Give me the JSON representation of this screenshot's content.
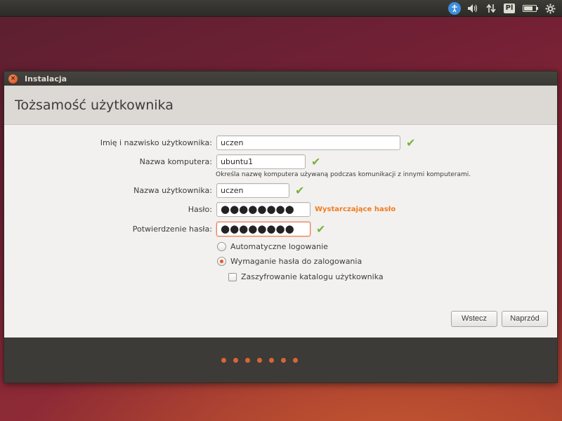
{
  "panel": {
    "keyboard_layout": "Pl",
    "icons": [
      "accessibility-icon",
      "volume-icon",
      "network-icon",
      "keyboard-layout-icon",
      "battery-icon",
      "settings-gear-icon"
    ],
    "battery_level": 0.75
  },
  "window": {
    "title": "Instalacja",
    "page_title": "Tożsamość użytkownika"
  },
  "form": {
    "fullname": {
      "label": "Imię i nazwisko użytkownika:",
      "value": "uczen",
      "valid": true
    },
    "computer": {
      "label": "Nazwa komputera:",
      "value": "ubuntu1",
      "valid": true,
      "hint": "Określa nazwę komputera używaną podczas komunikacji z innymi komputerami."
    },
    "username": {
      "label": "Nazwa użytkownika:",
      "value": "uczen",
      "valid": true
    },
    "password": {
      "label": "Hasło:",
      "value": "●●●●●●●●",
      "strength": "Wystarczające hasło"
    },
    "confirm": {
      "label": "Potwierdzenie hasła:",
      "value": "●●●●●●●●",
      "valid": true
    },
    "options": {
      "auto_login": {
        "label": "Automatyczne logowanie",
        "selected": false
      },
      "require_password": {
        "label": "Wymaganie hasła do zalogowania",
        "selected": true
      },
      "encrypt_home": {
        "label": "Zaszyfrowanie katalogu użytkownika",
        "checked": false
      }
    }
  },
  "buttons": {
    "back": "Wstecz",
    "forward": "Naprzód"
  },
  "progress": {
    "steps": 7
  },
  "colors": {
    "accent": "#e9591f",
    "valid_check": "#7ab437",
    "strength_text": "#f07c1f"
  }
}
